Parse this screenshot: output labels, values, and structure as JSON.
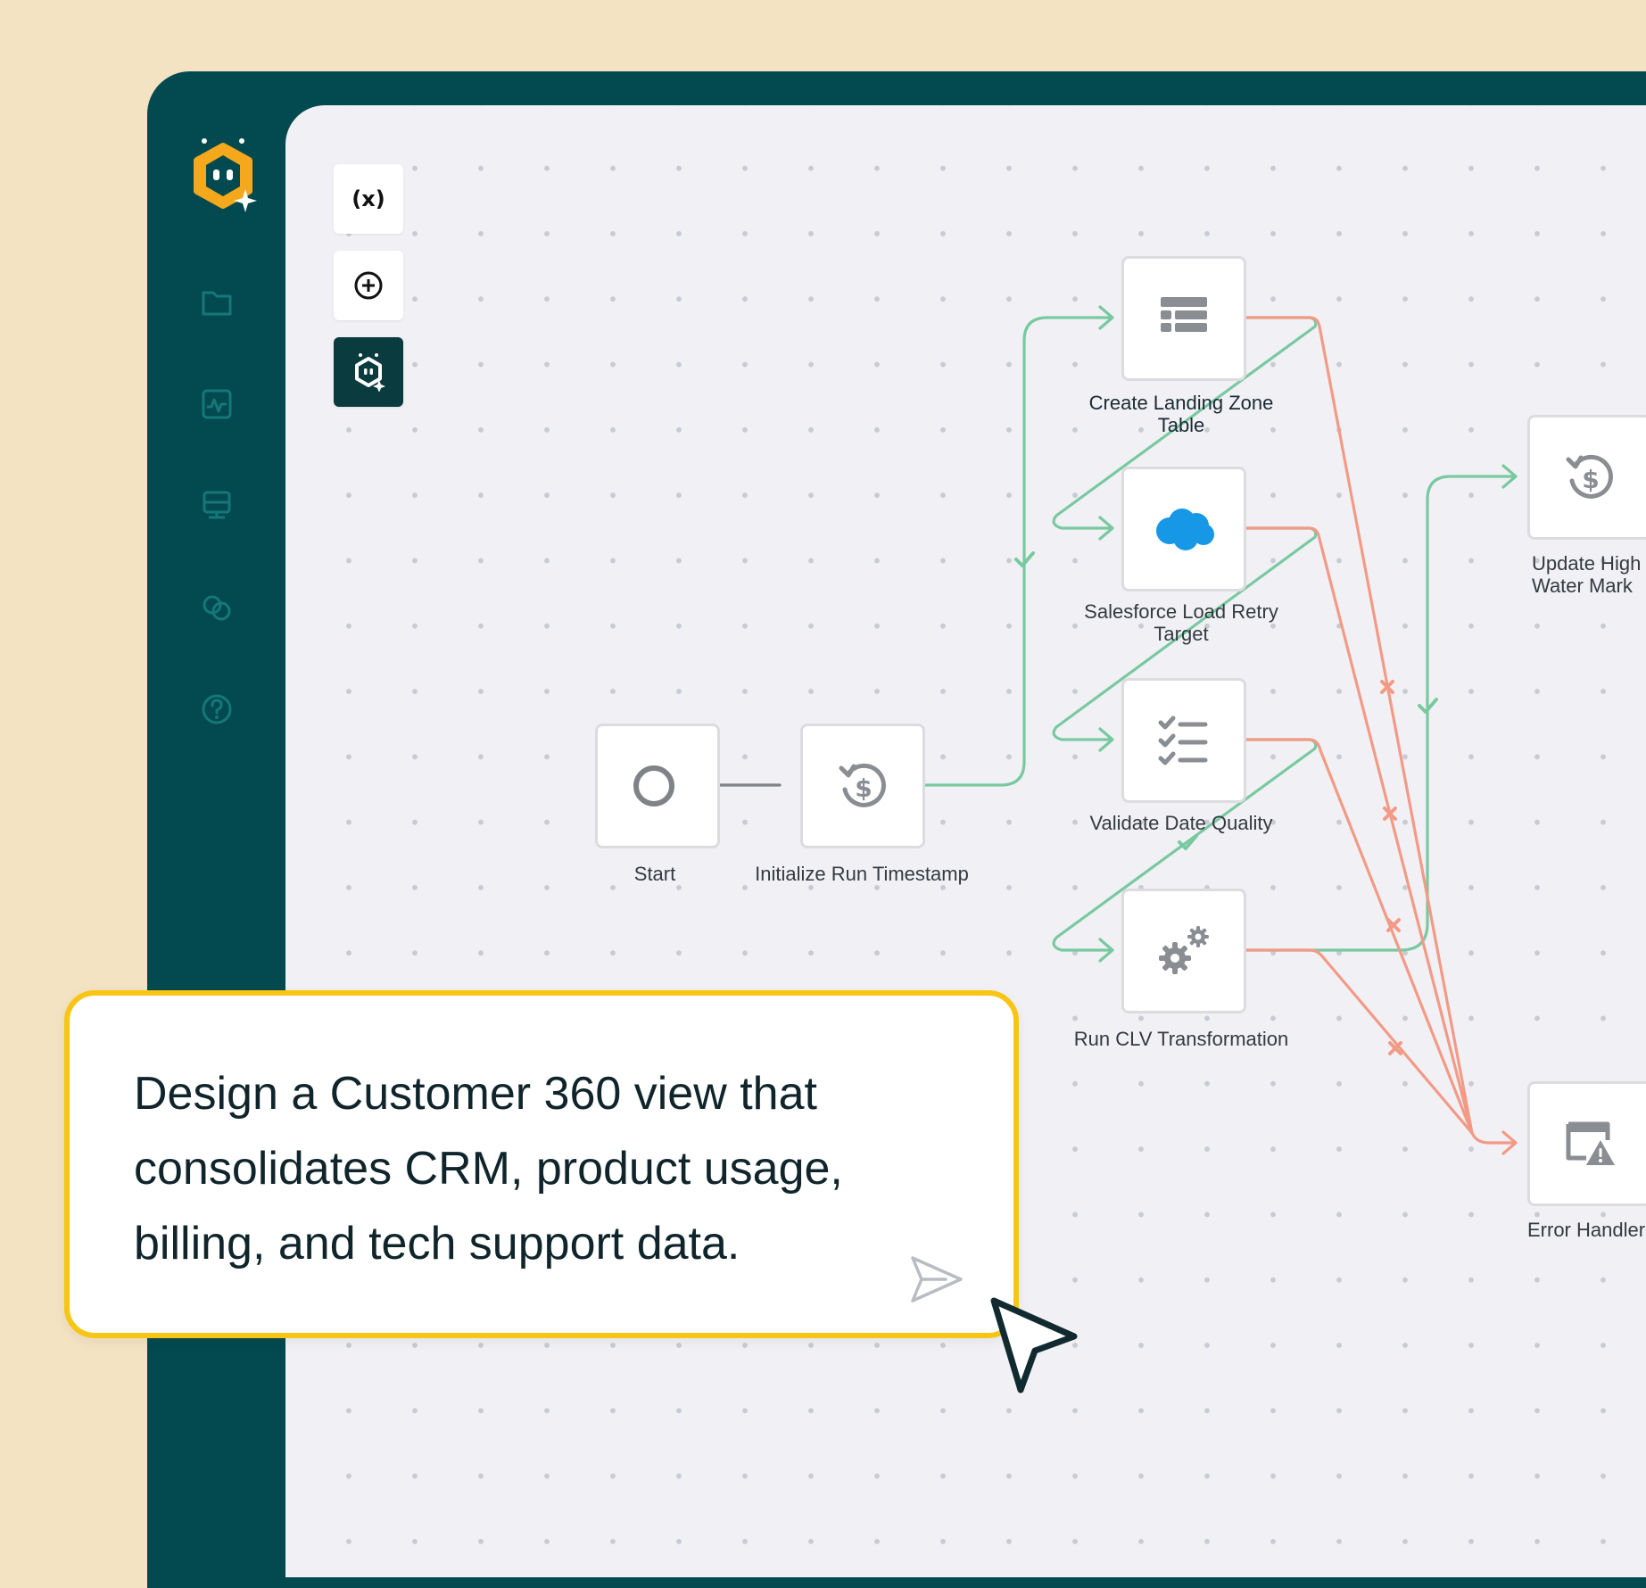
{
  "sidebar": {
    "logo": "bot-logo-icon",
    "items": [
      {
        "icon": "folder-icon"
      },
      {
        "icon": "activity-icon"
      },
      {
        "icon": "database-icon"
      },
      {
        "icon": "connections-icon"
      },
      {
        "icon": "help-icon"
      }
    ]
  },
  "toolbar": {
    "variables_label": "(x)",
    "add_icon": "plus-circle-icon",
    "assistant_icon": "bot-icon"
  },
  "workflow": {
    "nodes": {
      "start": {
        "label": "Start",
        "icon": "start-circle-icon"
      },
      "init_run": {
        "label": "Initialize Run Timestamp",
        "icon": "dollar-history-icon"
      },
      "landing_table": {
        "label": "Create Landing Zone Table",
        "icon": "table-icon"
      },
      "salesforce": {
        "label": "Salesforce Load Retry Target",
        "icon": "salesforce-cloud-icon"
      },
      "validate": {
        "label": "Validate Date Quality",
        "icon": "checklist-icon"
      },
      "clv": {
        "label": "Run CLV Transformation",
        "icon": "gears-icon"
      },
      "high_water": {
        "label": "Update High Water Mark",
        "icon": "dollar-history-icon"
      },
      "error_handler": {
        "label": "Error Handler",
        "icon": "window-warning-icon"
      }
    },
    "colors": {
      "success": "#78c9a0",
      "failure": "#f39a86"
    }
  },
  "prompt": {
    "text": "Design a Customer 360 view that consolidates CRM, product usage, billing, and tech support data.",
    "send_icon": "send-icon",
    "accent": "#f8c514"
  }
}
